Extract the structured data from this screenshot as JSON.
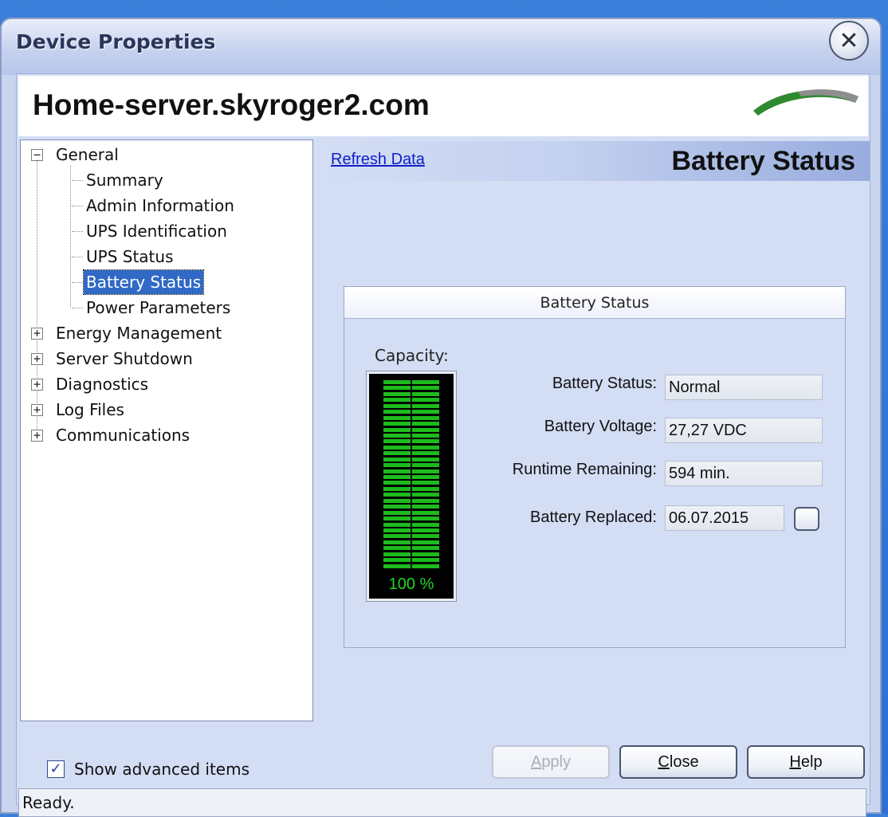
{
  "window": {
    "title": "Device Properties"
  },
  "header": {
    "server_name": "Home-server.skyroger2.com"
  },
  "tree": {
    "general": "General",
    "children": [
      "Summary",
      "Admin Information",
      "UPS Identification",
      "UPS Status",
      "Battery Status",
      "Power Parameters"
    ],
    "selected": "Battery Status",
    "collapsed": [
      "Energy Management",
      "Server Shutdown",
      "Diagnostics",
      "Log Files",
      "Communications"
    ]
  },
  "content": {
    "refresh_link": "Refresh Data",
    "title": "Battery Status",
    "panel_title": "Battery Status",
    "capacity_label": "Capacity:",
    "capacity_value": "100 %",
    "capacity_fraction": 1.0,
    "fields": {
      "battery_status": {
        "label": "Battery Status:",
        "value": "Normal"
      },
      "battery_voltage": {
        "label": "Battery Voltage:",
        "value": "27,27 VDC"
      },
      "runtime_remaining": {
        "label": "Runtime Remaining:",
        "value": "594 min."
      },
      "battery_replaced": {
        "label": "Battery Replaced:",
        "value": "06.07.2015"
      }
    }
  },
  "footer": {
    "show_advanced": {
      "label": "Show advanced items",
      "checked": true
    },
    "buttons": {
      "apply": "Apply",
      "close": "Close",
      "help": "Help"
    },
    "status": "Ready."
  },
  "colors": {
    "meter_green": "#1dbb1d",
    "selection": "#3169c6",
    "link": "#1020c8"
  },
  "icons": {
    "close": "close-icon",
    "logo": "green-swoosh-logo"
  }
}
